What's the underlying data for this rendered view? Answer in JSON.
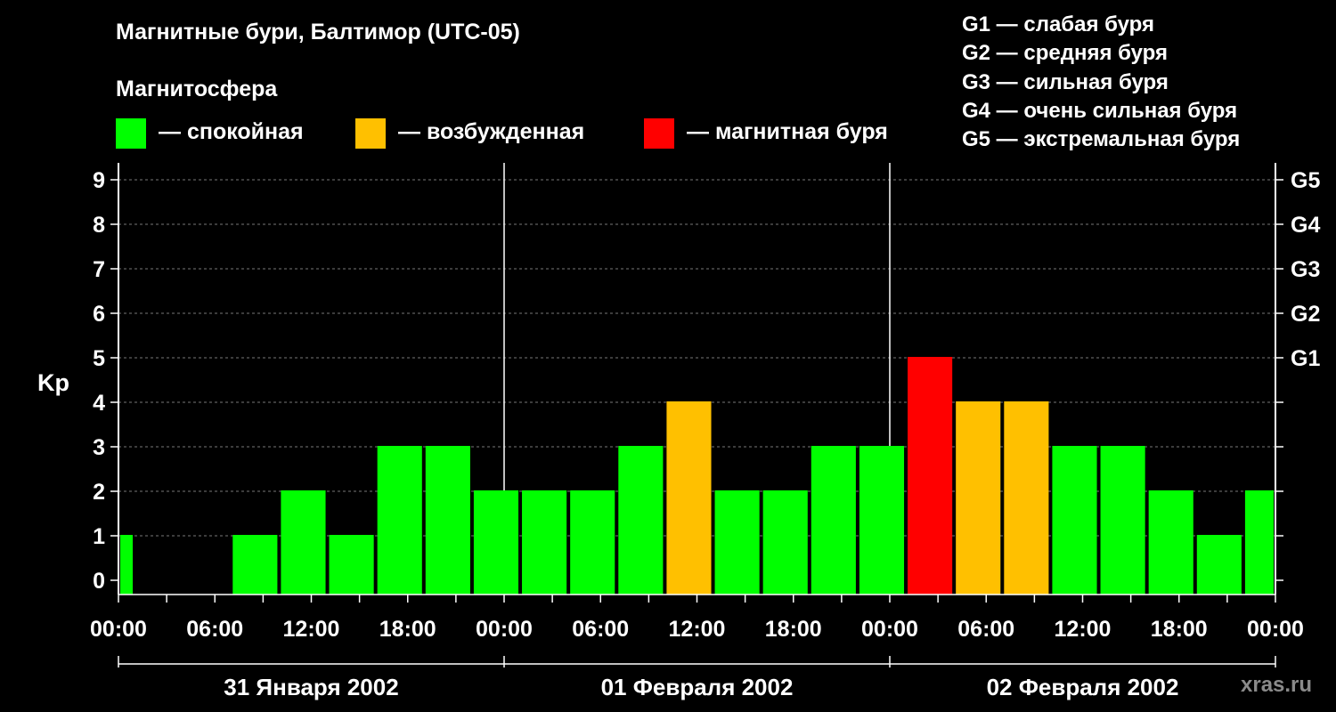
{
  "title": "Магнитные бури, Балтимор (UTC-05)",
  "subtitle": "Магнитосфера",
  "legend": [
    {
      "label": "— спокойная",
      "color": "#00ff00"
    },
    {
      "label": "— возбужденная",
      "color": "#ffc000"
    },
    {
      "label": "— магнитная буря",
      "color": "#ff0000"
    }
  ],
  "storm_levels": [
    "G1 — слабая буря",
    "G2 — средняя буря",
    "G3 — сильная буря",
    "G4 — очень сильная буря",
    "G5 — экстремальная буря"
  ],
  "watermark": "xras.ru",
  "chart_data": {
    "type": "bar",
    "ylabel": "Kp",
    "ylim": [
      0,
      9
    ],
    "yticks": [
      "0",
      "1",
      "2",
      "3",
      "4",
      "5",
      "6",
      "7",
      "8",
      "9"
    ],
    "right_ticks": [
      {
        "value": 5,
        "label": "G1"
      },
      {
        "value": 6,
        "label": "G2"
      },
      {
        "value": 7,
        "label": "G3"
      },
      {
        "value": 8,
        "label": "G4"
      },
      {
        "value": 9,
        "label": "G5"
      }
    ],
    "grid": true,
    "xtick_labels": [
      "00:00",
      "06:00",
      "12:00",
      "18:00",
      "00:00",
      "06:00",
      "12:00",
      "18:00",
      "00:00",
      "06:00",
      "12:00",
      "18:00",
      "00:00"
    ],
    "dates": [
      "31 Января 2002",
      "01 Февраля 2002",
      "02 Февраля 2002"
    ],
    "colors": {
      "quiet": "#00ff00",
      "active": "#ffc000",
      "storm": "#ff0000"
    },
    "series": [
      {
        "values": [
          {
            "start": "31.01.2002 00:00",
            "end": "31.01.2002 01:00",
            "kp": 1
          },
          {
            "start": "31.01.2002 07:00",
            "end": "31.01.2002 10:00",
            "kp": 1
          },
          {
            "start": "31.01.2002 10:00",
            "end": "31.01.2002 13:00",
            "kp": 2
          },
          {
            "start": "31.01.2002 13:00",
            "end": "31.01.2002 16:00",
            "kp": 1
          },
          {
            "start": "31.01.2002 16:00",
            "end": "31.01.2002 19:00",
            "kp": 3
          },
          {
            "start": "31.01.2002 19:00",
            "end": "31.01.2002 22:00",
            "kp": 3
          },
          {
            "start": "31.01.2002 22:00",
            "end": "01.02.2002 01:00",
            "kp": 2
          },
          {
            "start": "01.02.2002 01:00",
            "end": "01.02.2002 04:00",
            "kp": 2
          },
          {
            "start": "01.02.2002 04:00",
            "end": "01.02.2002 07:00",
            "kp": 2
          },
          {
            "start": "01.02.2002 07:00",
            "end": "01.02.2002 10:00",
            "kp": 3
          },
          {
            "start": "01.02.2002 10:00",
            "end": "01.02.2002 13:00",
            "kp": 4
          },
          {
            "start": "01.02.2002 13:00",
            "end": "01.02.2002 16:00",
            "kp": 2
          },
          {
            "start": "01.02.2002 16:00",
            "end": "01.02.2002 19:00",
            "kp": 2
          },
          {
            "start": "01.02.2002 19:00",
            "end": "01.02.2002 22:00",
            "kp": 3
          },
          {
            "start": "01.02.2002 22:00",
            "end": "02.02.2002 01:00",
            "kp": 3
          },
          {
            "start": "02.02.2002 01:00",
            "end": "02.02.2002 04:00",
            "kp": 5
          },
          {
            "start": "02.02.2002 04:00",
            "end": "02.02.2002 07:00",
            "kp": 4
          },
          {
            "start": "02.02.2002 07:00",
            "end": "02.02.2002 10:00",
            "kp": 4
          },
          {
            "start": "02.02.2002 10:00",
            "end": "02.02.2002 13:00",
            "kp": 3
          },
          {
            "start": "02.02.2002 13:00",
            "end": "02.02.2002 16:00",
            "kp": 3
          },
          {
            "start": "02.02.2002 16:00",
            "end": "02.02.2002 19:00",
            "kp": 2
          },
          {
            "start": "02.02.2002 19:00",
            "end": "02.02.2002 22:00",
            "kp": 1
          },
          {
            "start": "02.02.2002 22:00",
            "end": "03.02.2002 00:00",
            "kp": 2
          }
        ]
      }
    ]
  }
}
